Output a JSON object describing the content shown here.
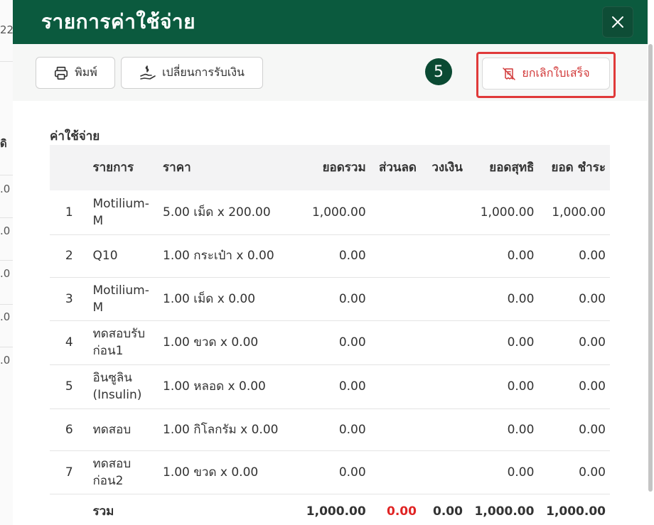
{
  "background": {
    "fragments": [
      "22",
      "ดิ",
      ".0",
      ".0",
      ".0",
      ".0",
      ".0"
    ]
  },
  "modal": {
    "title": "รายการค่าใช้จ่าย",
    "close_icon": "close-icon"
  },
  "toolbar": {
    "print_label": "พิมพ์",
    "print_icon": "printer-icon",
    "change_payment_label": "เปลี่ยนการรับเงิน",
    "change_payment_icon": "hand-money-icon",
    "step_number": "5",
    "cancel_receipt_label": "ยกเลิกใบเสร็จ",
    "cancel_receipt_icon": "receipt-off-icon"
  },
  "expenses": {
    "section_title": "ค่าใช้จ่าย",
    "columns": [
      "",
      "รายการ",
      "ราคา",
      "ยอดรวม",
      "ส่วนลด",
      "วงเงิน",
      "ยอดสุทธิ",
      "ยอด ชำระ"
    ],
    "rows": [
      {
        "idx": "1",
        "item": "Motilium-M",
        "price": "5.00 เม็ด x 200.00",
        "total": "1,000.00",
        "discount": "",
        "limit": "",
        "net": "1,000.00",
        "paid": "1,000.00"
      },
      {
        "idx": "2",
        "item": "Q10",
        "price": "1.00 กระเป๋า x 0.00",
        "total": "0.00",
        "discount": "",
        "limit": "",
        "net": "0.00",
        "paid": "0.00"
      },
      {
        "idx": "3",
        "item": "Motilium-M",
        "price": "1.00 เม็ด x 0.00",
        "total": "0.00",
        "discount": "",
        "limit": "",
        "net": "0.00",
        "paid": "0.00"
      },
      {
        "idx": "4",
        "item": "ทดสอบรับก่อน1",
        "price": "1.00 ขวด x 0.00",
        "total": "0.00",
        "discount": "",
        "limit": "",
        "net": "0.00",
        "paid": "0.00"
      },
      {
        "idx": "5",
        "item": "อินซูลิน (Insulin)",
        "price": "1.00 หลอด x 0.00",
        "total": "0.00",
        "discount": "",
        "limit": "",
        "net": "0.00",
        "paid": "0.00"
      },
      {
        "idx": "6",
        "item": "ทดสอบ",
        "price": "1.00 กิโลกรัม x 0.00",
        "total": "0.00",
        "discount": "",
        "limit": "",
        "net": "0.00",
        "paid": "0.00"
      },
      {
        "idx": "7",
        "item": "ทดสอบก่อน2",
        "price": "1.00 ขวด x 0.00",
        "total": "0.00",
        "discount": "",
        "limit": "",
        "net": "0.00",
        "paid": "0.00"
      }
    ],
    "footer": {
      "label": "รวม",
      "total": "1,000.00",
      "discount": "0.00",
      "limit": "0.00",
      "net": "1,000.00",
      "paid": "1,000.00"
    }
  },
  "colors": {
    "header_green": "#0b5a3e",
    "highlight_red": "#e03a3a",
    "discount_red": "#e02424"
  }
}
